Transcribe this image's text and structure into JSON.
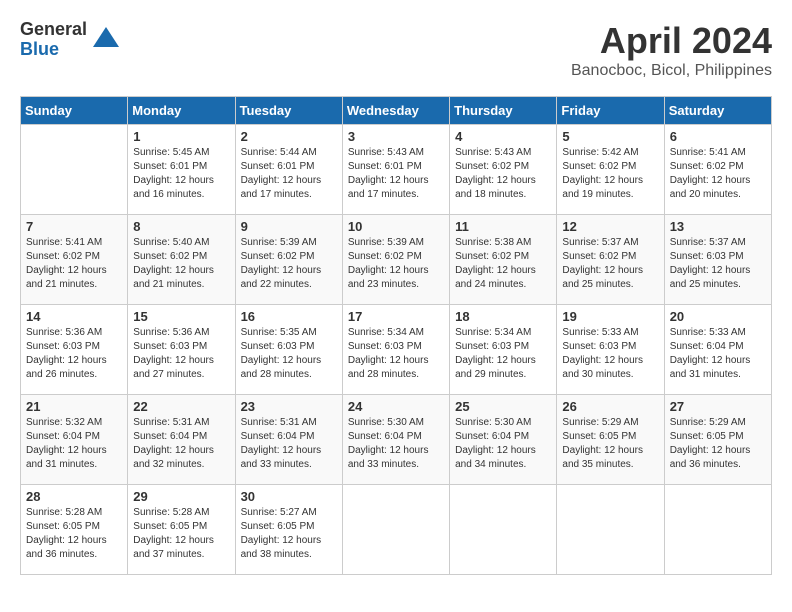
{
  "logo": {
    "general": "General",
    "blue": "Blue"
  },
  "title": "April 2024",
  "location": "Banocboc, Bicol, Philippines",
  "days_of_week": [
    "Sunday",
    "Monday",
    "Tuesday",
    "Wednesday",
    "Thursday",
    "Friday",
    "Saturday"
  ],
  "weeks": [
    [
      {
        "day": "",
        "info": ""
      },
      {
        "day": "1",
        "info": "Sunrise: 5:45 AM\nSunset: 6:01 PM\nDaylight: 12 hours\nand 16 minutes."
      },
      {
        "day": "2",
        "info": "Sunrise: 5:44 AM\nSunset: 6:01 PM\nDaylight: 12 hours\nand 17 minutes."
      },
      {
        "day": "3",
        "info": "Sunrise: 5:43 AM\nSunset: 6:01 PM\nDaylight: 12 hours\nand 17 minutes."
      },
      {
        "day": "4",
        "info": "Sunrise: 5:43 AM\nSunset: 6:02 PM\nDaylight: 12 hours\nand 18 minutes."
      },
      {
        "day": "5",
        "info": "Sunrise: 5:42 AM\nSunset: 6:02 PM\nDaylight: 12 hours\nand 19 minutes."
      },
      {
        "day": "6",
        "info": "Sunrise: 5:41 AM\nSunset: 6:02 PM\nDaylight: 12 hours\nand 20 minutes."
      }
    ],
    [
      {
        "day": "7",
        "info": "Sunrise: 5:41 AM\nSunset: 6:02 PM\nDaylight: 12 hours\nand 21 minutes."
      },
      {
        "day": "8",
        "info": "Sunrise: 5:40 AM\nSunset: 6:02 PM\nDaylight: 12 hours\nand 21 minutes."
      },
      {
        "day": "9",
        "info": "Sunrise: 5:39 AM\nSunset: 6:02 PM\nDaylight: 12 hours\nand 22 minutes."
      },
      {
        "day": "10",
        "info": "Sunrise: 5:39 AM\nSunset: 6:02 PM\nDaylight: 12 hours\nand 23 minutes."
      },
      {
        "day": "11",
        "info": "Sunrise: 5:38 AM\nSunset: 6:02 PM\nDaylight: 12 hours\nand 24 minutes."
      },
      {
        "day": "12",
        "info": "Sunrise: 5:37 AM\nSunset: 6:02 PM\nDaylight: 12 hours\nand 25 minutes."
      },
      {
        "day": "13",
        "info": "Sunrise: 5:37 AM\nSunset: 6:03 PM\nDaylight: 12 hours\nand 25 minutes."
      }
    ],
    [
      {
        "day": "14",
        "info": "Sunrise: 5:36 AM\nSunset: 6:03 PM\nDaylight: 12 hours\nand 26 minutes."
      },
      {
        "day": "15",
        "info": "Sunrise: 5:36 AM\nSunset: 6:03 PM\nDaylight: 12 hours\nand 27 minutes."
      },
      {
        "day": "16",
        "info": "Sunrise: 5:35 AM\nSunset: 6:03 PM\nDaylight: 12 hours\nand 28 minutes."
      },
      {
        "day": "17",
        "info": "Sunrise: 5:34 AM\nSunset: 6:03 PM\nDaylight: 12 hours\nand 28 minutes."
      },
      {
        "day": "18",
        "info": "Sunrise: 5:34 AM\nSunset: 6:03 PM\nDaylight: 12 hours\nand 29 minutes."
      },
      {
        "day": "19",
        "info": "Sunrise: 5:33 AM\nSunset: 6:03 PM\nDaylight: 12 hours\nand 30 minutes."
      },
      {
        "day": "20",
        "info": "Sunrise: 5:33 AM\nSunset: 6:04 PM\nDaylight: 12 hours\nand 31 minutes."
      }
    ],
    [
      {
        "day": "21",
        "info": "Sunrise: 5:32 AM\nSunset: 6:04 PM\nDaylight: 12 hours\nand 31 minutes."
      },
      {
        "day": "22",
        "info": "Sunrise: 5:31 AM\nSunset: 6:04 PM\nDaylight: 12 hours\nand 32 minutes."
      },
      {
        "day": "23",
        "info": "Sunrise: 5:31 AM\nSunset: 6:04 PM\nDaylight: 12 hours\nand 33 minutes."
      },
      {
        "day": "24",
        "info": "Sunrise: 5:30 AM\nSunset: 6:04 PM\nDaylight: 12 hours\nand 33 minutes."
      },
      {
        "day": "25",
        "info": "Sunrise: 5:30 AM\nSunset: 6:04 PM\nDaylight: 12 hours\nand 34 minutes."
      },
      {
        "day": "26",
        "info": "Sunrise: 5:29 AM\nSunset: 6:05 PM\nDaylight: 12 hours\nand 35 minutes."
      },
      {
        "day": "27",
        "info": "Sunrise: 5:29 AM\nSunset: 6:05 PM\nDaylight: 12 hours\nand 36 minutes."
      }
    ],
    [
      {
        "day": "28",
        "info": "Sunrise: 5:28 AM\nSunset: 6:05 PM\nDaylight: 12 hours\nand 36 minutes."
      },
      {
        "day": "29",
        "info": "Sunrise: 5:28 AM\nSunset: 6:05 PM\nDaylight: 12 hours\nand 37 minutes."
      },
      {
        "day": "30",
        "info": "Sunrise: 5:27 AM\nSunset: 6:05 PM\nDaylight: 12 hours\nand 38 minutes."
      },
      {
        "day": "",
        "info": ""
      },
      {
        "day": "",
        "info": ""
      },
      {
        "day": "",
        "info": ""
      },
      {
        "day": "",
        "info": ""
      }
    ]
  ]
}
